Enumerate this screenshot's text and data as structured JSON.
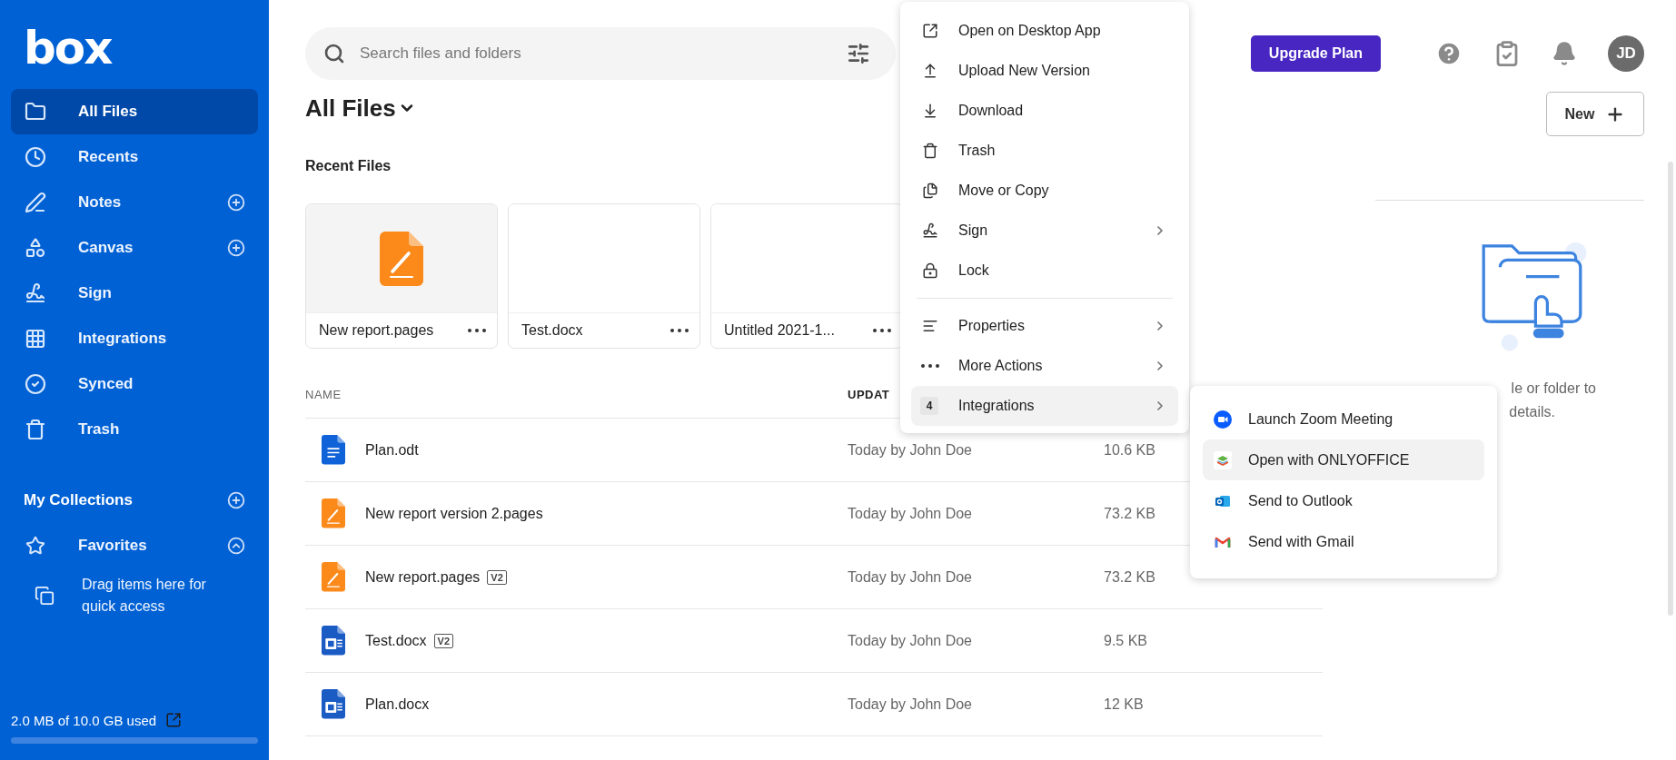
{
  "sidebar": {
    "logo": "box",
    "items": [
      {
        "label": "All Files",
        "selected": true,
        "add_button": false
      },
      {
        "label": "Recents",
        "selected": false,
        "add_button": false
      },
      {
        "label": "Notes",
        "selected": false,
        "add_button": true
      },
      {
        "label": "Canvas",
        "selected": false,
        "add_button": true
      },
      {
        "label": "Sign",
        "selected": false,
        "add_button": false
      },
      {
        "label": "Integrations",
        "selected": false,
        "add_button": false
      },
      {
        "label": "Synced",
        "selected": false,
        "add_button": false
      },
      {
        "label": "Trash",
        "selected": false,
        "add_button": false
      }
    ],
    "collections": {
      "label": "My Collections"
    },
    "favorites": {
      "label": "Favorites",
      "expanded": true,
      "hint": "Drag items here for quick access"
    },
    "storage": {
      "text": "2.0 MB of 10.0 GB used"
    }
  },
  "search": {
    "placeholder": "Search files and folders"
  },
  "header": {
    "upgrade_button": "Upgrade Plan",
    "avatar": "JD"
  },
  "page_title": "All Files",
  "recent_title": "Recent Files",
  "recent_files": [
    {
      "name": "New report.pages",
      "kind": "pages"
    },
    {
      "name": "Test.docx",
      "kind": "blank"
    },
    {
      "name": "Untitled 2021-1...",
      "kind": "blank"
    }
  ],
  "table": {
    "columns": [
      "NAME",
      "UPDAT"
    ],
    "rows": [
      {
        "name": "Plan.odt",
        "kind": "doc",
        "updated": "Today by John Doe",
        "size": "10.6 KB"
      },
      {
        "name": "New report version 2.pages",
        "kind": "pages",
        "updated": "Today by John Doe",
        "size": "73.2 KB"
      },
      {
        "name": "New report.pages",
        "kind": "pages",
        "version": "V2",
        "updated": "Today by John Doe",
        "size": "73.2 KB"
      },
      {
        "name": "Test.docx",
        "kind": "word",
        "version": "V2",
        "updated": "Today by John Doe",
        "size": "9.5 KB"
      },
      {
        "name": "Plan.docx",
        "kind": "word",
        "updated": "Today by John Doe",
        "size": "12 KB"
      }
    ]
  },
  "context_menu": {
    "groups": [
      [
        {
          "label": "Open on Desktop App",
          "submenu": false,
          "selected": false
        },
        {
          "label": "Upload New Version",
          "submenu": false,
          "selected": false
        },
        {
          "label": "Download",
          "submenu": false,
          "selected": false
        },
        {
          "label": "Trash",
          "submenu": false,
          "selected": false
        },
        {
          "label": "Move or Copy",
          "submenu": false,
          "selected": false
        },
        {
          "label": "Sign",
          "submenu": true,
          "selected": false
        },
        {
          "label": "Lock",
          "submenu": false,
          "selected": false
        }
      ],
      [
        {
          "label": "Properties",
          "submenu": true,
          "selected": false
        },
        {
          "label": "More Actions",
          "submenu": true,
          "selected": false
        },
        {
          "label": "Integrations",
          "submenu": true,
          "selected": true,
          "badge": "4"
        }
      ]
    ]
  },
  "submenu": {
    "items": [
      {
        "label": "Launch Zoom Meeting",
        "selected": false
      },
      {
        "label": "Open with ONLYOFFICE",
        "selected": true
      },
      {
        "label": "Send to Outlook",
        "selected": false
      },
      {
        "label": "Send with Gmail",
        "selected": false
      }
    ]
  },
  "right_panel": {
    "new_button": "New",
    "empty_text": [
      "le or folder to",
      "details."
    ]
  }
}
